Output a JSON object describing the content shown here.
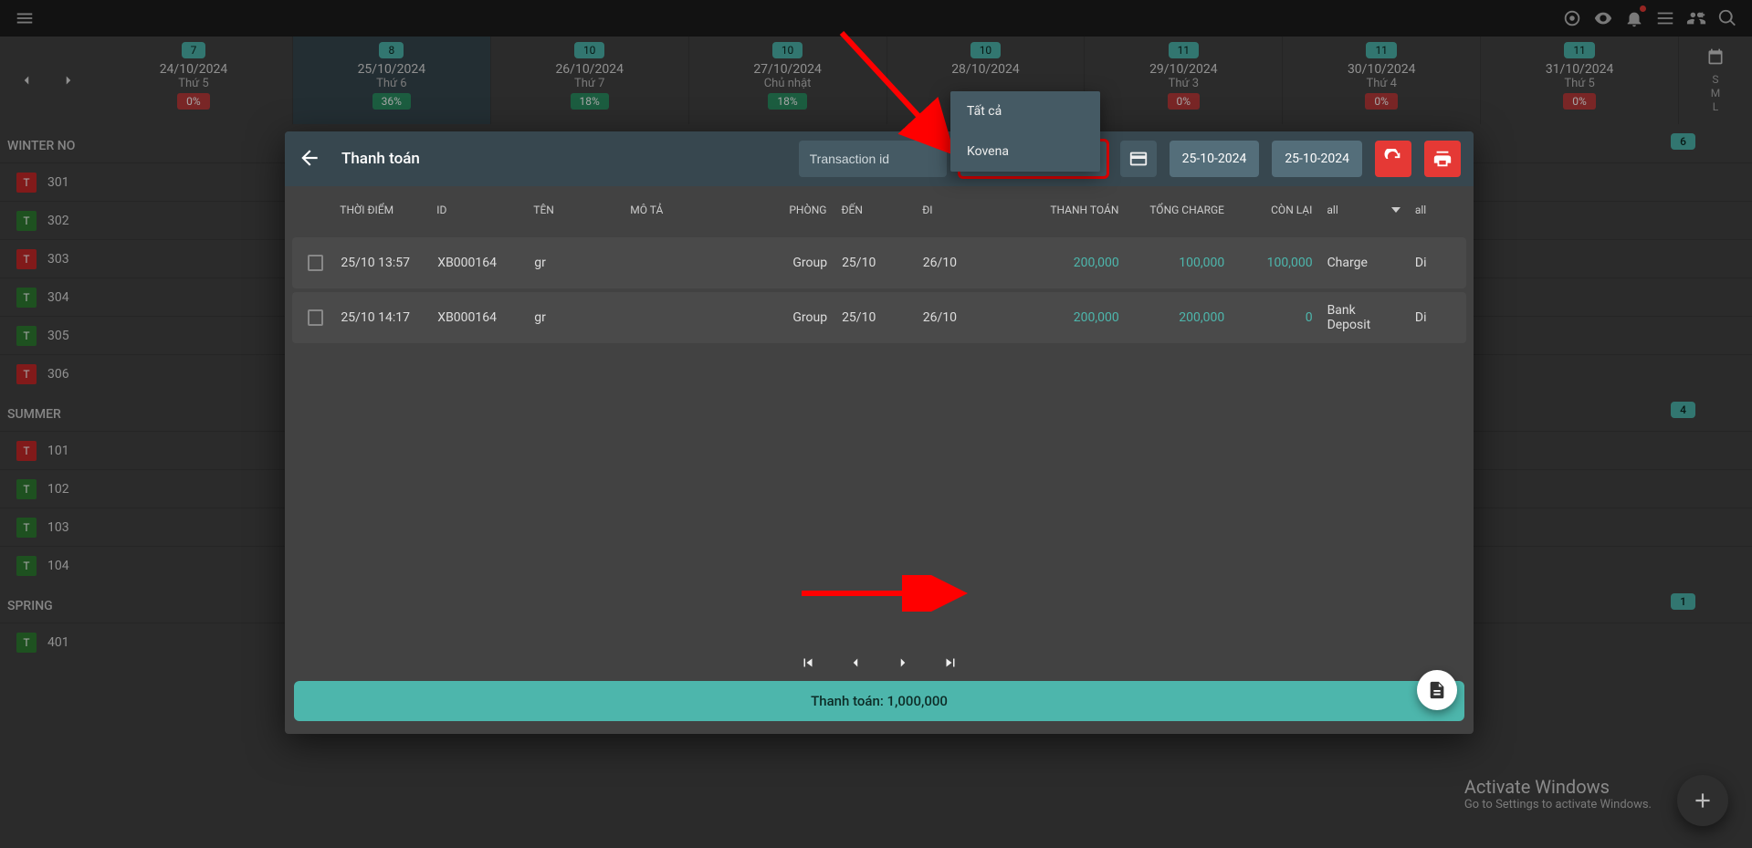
{
  "appbar": {},
  "calendar": {
    "days": [
      {
        "badge": "7",
        "date": "24/10/2024",
        "dow": "Thứ 5",
        "pct": "0%",
        "pct_green": false
      },
      {
        "badge": "8",
        "date": "25/10/2024",
        "dow": "Thứ 6",
        "pct": "36%",
        "pct_green": true,
        "active": true
      },
      {
        "badge": "10",
        "date": "26/10/2024",
        "dow": "Thứ 7",
        "pct": "18%",
        "pct_green": true
      },
      {
        "badge": "10",
        "date": "27/10/2024",
        "dow": "Chủ nhật",
        "pct": "18%",
        "pct_green": true
      },
      {
        "badge": "10",
        "date": "28/10/2024",
        "dow": "",
        "pct": "",
        "pct_green": false
      },
      {
        "badge": "11",
        "date": "29/10/2024",
        "dow": "Thứ 3",
        "pct": "0%",
        "pct_green": false
      },
      {
        "badge": "11",
        "date": "30/10/2024",
        "dow": "Thứ 4",
        "pct": "0%",
        "pct_green": false
      },
      {
        "badge": "11",
        "date": "31/10/2024",
        "dow": "Thứ 5",
        "pct": "0%",
        "pct_green": false
      }
    ],
    "sml": [
      "S",
      "M",
      "L"
    ]
  },
  "sections": [
    {
      "title": "WINTER NO",
      "badge": "6",
      "rooms": [
        {
          "t": "T",
          "num": "301",
          "red": true
        },
        {
          "t": "T",
          "num": "302",
          "red": false
        },
        {
          "t": "T",
          "num": "303",
          "red": true
        },
        {
          "t": "T",
          "num": "304",
          "red": false
        },
        {
          "t": "T",
          "num": "305",
          "red": false
        },
        {
          "t": "T",
          "num": "306",
          "red": true
        }
      ]
    },
    {
      "title": "SUMMER",
      "badge": "4",
      "rooms": [
        {
          "t": "T",
          "num": "101",
          "red": true
        },
        {
          "t": "T",
          "num": "102",
          "red": false
        },
        {
          "t": "T",
          "num": "103",
          "red": false
        },
        {
          "t": "T",
          "num": "104",
          "red": false
        }
      ]
    },
    {
      "title": "SPRING",
      "badge": "1",
      "rooms": [
        {
          "t": "T",
          "num": "401",
          "red": false
        }
      ]
    }
  ],
  "dialog": {
    "title": "Thanh toán",
    "tid_placeholder": "Transaction id",
    "kovena": "Kovena",
    "date_from": "25-10-2024",
    "date_to": "25-10-2024",
    "cols": {
      "time": "THỜI ĐIỂM",
      "id": "ID",
      "name": "TÊN",
      "desc": "MÔ TẢ",
      "room": "PHÒNG",
      "in": "ĐẾN",
      "out": "ĐI",
      "pay": "THANH TOÁN",
      "charge": "TỔNG CHARGE",
      "rest": "CÒN LẠI",
      "all1": "all",
      "all2": "all"
    },
    "rows": [
      {
        "time": "25/10 13:57",
        "id": "XB000164",
        "name": "gr",
        "desc": "",
        "room": "Group",
        "in": "25/10",
        "out": "26/10",
        "pay": "200,000",
        "charge": "100,000",
        "rest": "100,000",
        "method": "Charge",
        "last": "Di"
      },
      {
        "time": "25/10 14:17",
        "id": "XB000164",
        "name": "gr",
        "desc": "",
        "room": "Group",
        "in": "25/10",
        "out": "26/10",
        "pay": "200,000",
        "charge": "200,000",
        "rest": "0",
        "method": "Bank Deposit",
        "last": "Di"
      }
    ],
    "total_label": "Thanh toán: 1,000,000"
  },
  "dd": {
    "item1": "Tất cả",
    "item2": "Kovena"
  },
  "watermark": {
    "line1": "Activate Windows",
    "line2": "Go to Settings to activate Windows."
  }
}
